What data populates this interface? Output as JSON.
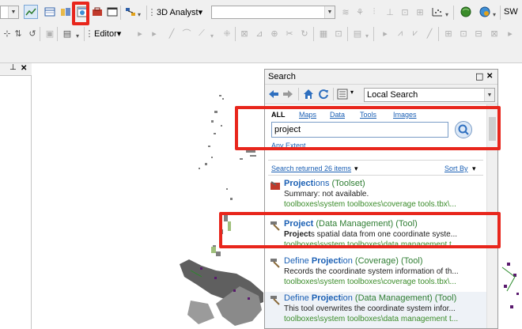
{
  "toolbar": {
    "analyst_label": "3D Analyst",
    "analyst_arrow": "▾",
    "sw_label": "SW",
    "editor_label": "Editor",
    "editor_arrow": "▾",
    "search_button_icon": "search-window-icon",
    "highlight_color": "#e8261c"
  },
  "left_dock": {
    "pin_glyph": "⊥",
    "close_glyph": "✕"
  },
  "search_window": {
    "title": "Search",
    "restore_glyph": "□",
    "close_glyph": "✕",
    "scope_value": "Local Search",
    "categories": [
      {
        "label": "ALL"
      },
      {
        "label": "Maps"
      },
      {
        "label": "Data"
      },
      {
        "label": "Tools"
      },
      {
        "label": "Images"
      }
    ],
    "query": "project",
    "extent_link": "Any Extent",
    "results_count": "Search returned 26 items",
    "results_arrow": "▾",
    "sort_label": "Sort By",
    "sort_arrow": "▾",
    "results": [
      {
        "name_bold": "Project",
        "name_rest": "ions",
        "kind": " (Toolset)",
        "desc_bold": "",
        "desc": "Summary: not available.",
        "path": "toolboxes\\system toolboxes\\coverage tools.tbx\\...",
        "icon": "toolset-icon"
      },
      {
        "name_bold": "Project",
        "name_rest": "",
        "kind": " (Data Management)  (Tool)",
        "desc_bold": "Project",
        "desc": "s spatial data from one coordinate syste...",
        "path": "toolboxes\\system toolboxes\\data management t...",
        "icon": "hammer-icon"
      },
      {
        "name_prefix": "Define ",
        "name_bold": "Project",
        "name_rest": "ion",
        "kind": " (Coverage)  (Tool)",
        "desc_bold": "",
        "desc": "Records the coordinate system information of th...",
        "path": "toolboxes\\system toolboxes\\coverage tools.tbx\\...",
        "icon": "hammer-icon"
      },
      {
        "name_prefix": "Define ",
        "name_bold": "Project",
        "name_rest": "ion",
        "kind": " (Data Management)  (Tool)",
        "desc_bold": "",
        "desc": "This tool overwrites the coordinate system infor...",
        "path": "toolboxes\\system toolboxes\\data management t...",
        "icon": "hammer-icon"
      }
    ]
  }
}
